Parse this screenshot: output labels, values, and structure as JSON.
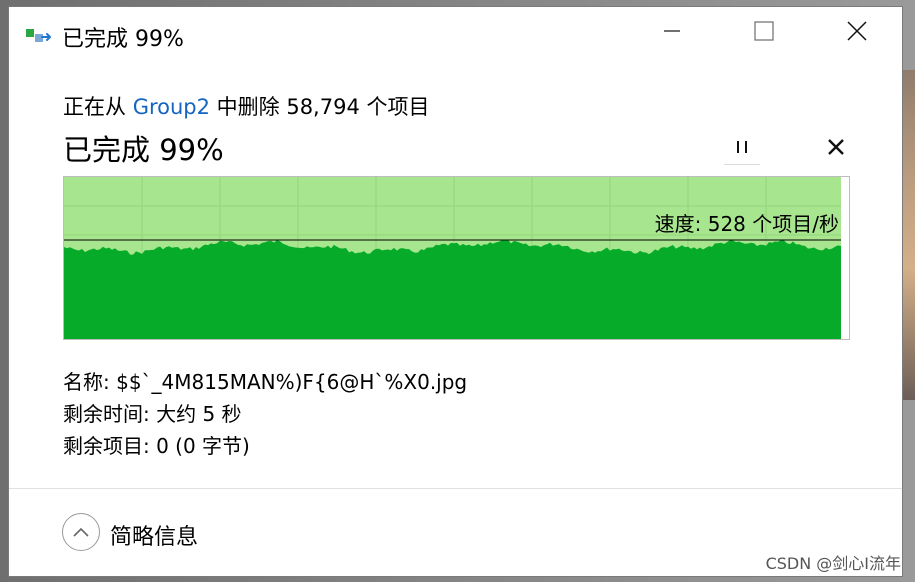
{
  "window": {
    "title": "已完成 99%",
    "controls": {
      "minimize_icon": "minimize-icon",
      "maximize_icon": "maximize-icon",
      "close_icon": "close-icon"
    }
  },
  "operation": {
    "prefix": "正在从 ",
    "source": "Group2",
    "suffix": " 中删除 58,794 个项目"
  },
  "progress": {
    "title": "已完成 99%",
    "percent": 99,
    "pause_icon": "pause-icon",
    "cancel_icon": "close-icon"
  },
  "graph": {
    "speed_text": "速度: 528 个项目/秒",
    "colors": {
      "fill_dark": "#06ac29",
      "fill_light": "#a8e58f",
      "grid": "#92d87a",
      "speed_line": "#000000"
    }
  },
  "details": {
    "name": "名称:  $$`_4M815MAN%)F{6@H`%X0.jpg",
    "time_remaining": "剩余时间:  大约 5 秒",
    "items_remaining": "剩余项目:  0 (0 字节)",
    "toggle_label": "简略信息"
  },
  "watermark": "CSDN @剑心I流年"
}
